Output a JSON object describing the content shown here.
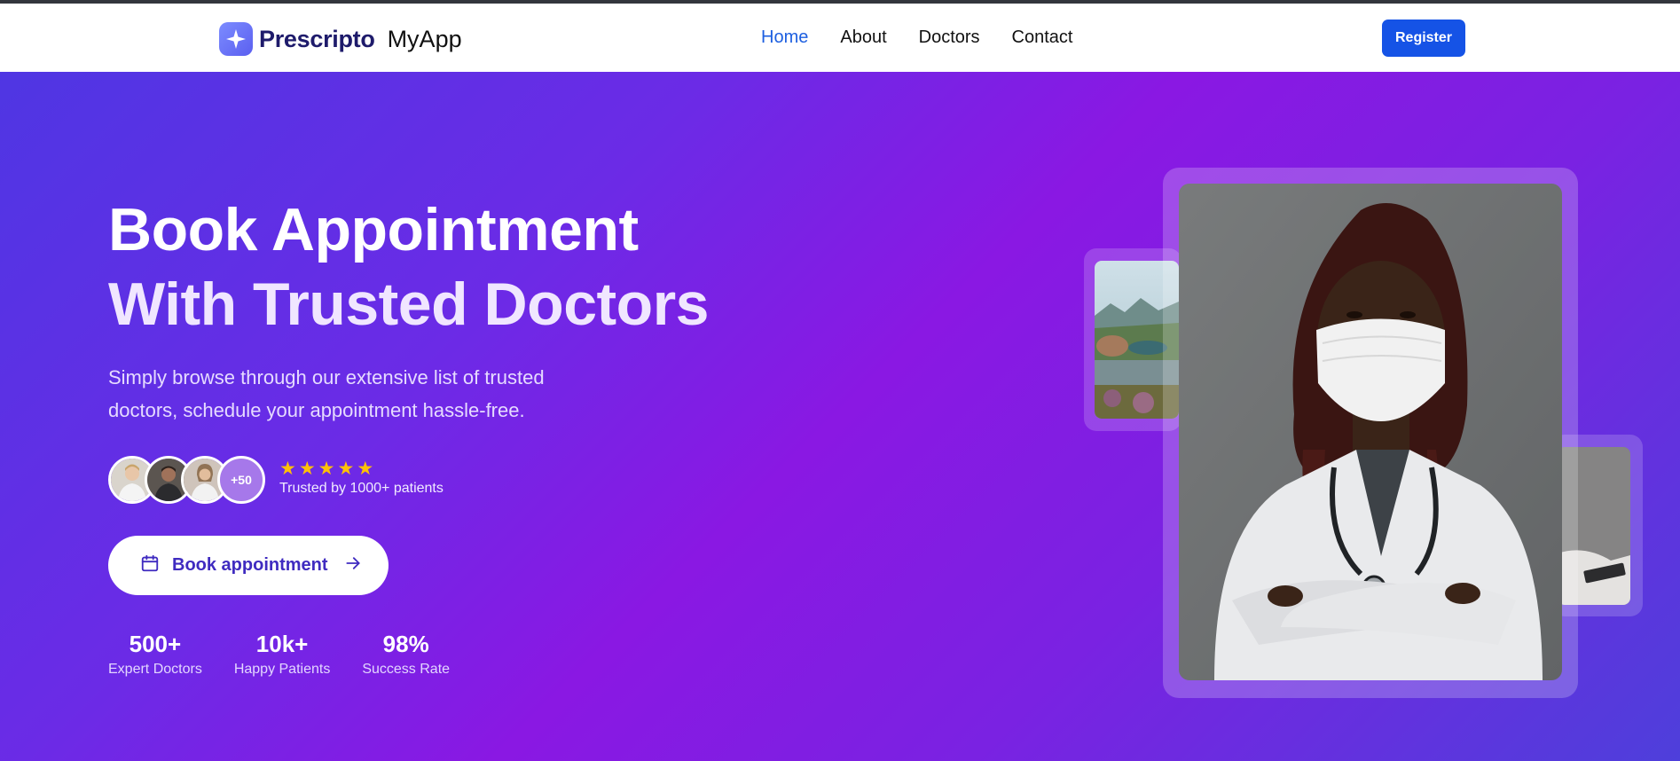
{
  "brand": {
    "name": "Prescripto",
    "app": "MyApp"
  },
  "nav": {
    "items": [
      {
        "label": "Home",
        "active": true
      },
      {
        "label": "About",
        "active": false
      },
      {
        "label": "Doctors",
        "active": false
      },
      {
        "label": "Contact",
        "active": false
      }
    ],
    "register_label": "Register"
  },
  "hero": {
    "headline_line1": "Book Appointment",
    "headline_line2": "With Trusted Doctors",
    "subtext_line1": "Simply browse through our extensive list of trusted",
    "subtext_line2": "doctors, schedule your appointment hassle-free.",
    "more_count": "+50",
    "rating_stars": 5,
    "rating_text": "Trusted by 1000+ patients",
    "cta_label": "Book appointment",
    "stats": [
      {
        "value": "500+",
        "label": "Expert Doctors"
      },
      {
        "value": "10k+",
        "label": "Happy Patients"
      },
      {
        "value": "98%",
        "label": "Success Rate"
      }
    ]
  },
  "colors": {
    "accent": "#1553e6",
    "nav_active": "#1d5fe0",
    "hero_gradient_start": "#4f36e3",
    "hero_gradient_mid": "#8a18e3",
    "star": "#ffc107",
    "cta_text": "#3f2bc0"
  },
  "icons": {
    "logo": "sparkle-icon",
    "cta_left": "calendar-icon",
    "cta_right": "arrow-right-icon",
    "star": "star-icon"
  }
}
